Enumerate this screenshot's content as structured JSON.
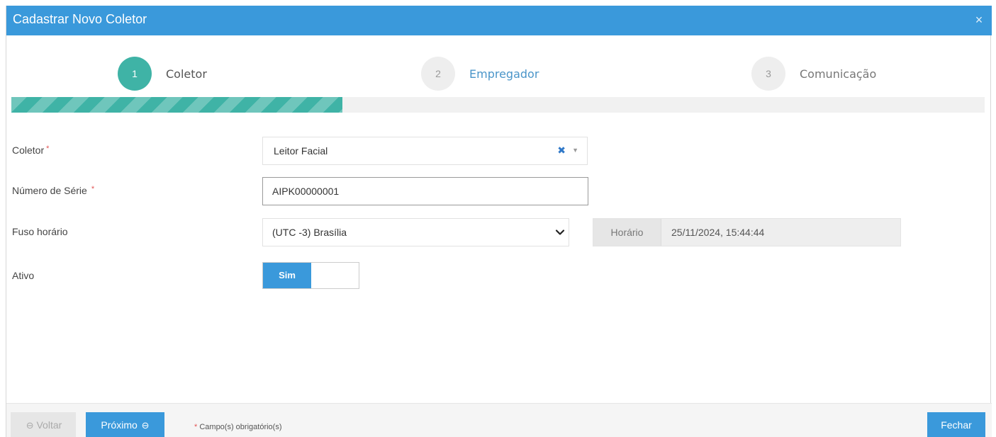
{
  "modal": {
    "title": "Cadastrar Novo Coletor",
    "close_glyph": "×"
  },
  "steps": [
    {
      "number": "1",
      "label": "Coletor",
      "state": "active"
    },
    {
      "number": "2",
      "label": "Empregador",
      "state": "upcoming"
    },
    {
      "number": "3",
      "label": "Comunicação",
      "state": "upcoming"
    }
  ],
  "progress": {
    "current_step": 1,
    "total_steps": 3,
    "fraction": 0.34
  },
  "form": {
    "coletor": {
      "label": "Coletor",
      "required_mark": "*",
      "value": "Leitor Facial"
    },
    "numero_serie": {
      "label": "Número de Série",
      "required_mark": "*",
      "value": "AIPK00000001"
    },
    "fuso_horario": {
      "label": "Fuso horário",
      "value": "(UTC -3) Brasília"
    },
    "horario": {
      "label": "Horário",
      "value": "25/11/2024, 15:44:44"
    },
    "ativo": {
      "label": "Ativo",
      "value": "Sim"
    }
  },
  "footer": {
    "back_label": "Voltar",
    "next_label": "Próximo",
    "close_label": "Fechar",
    "required_star": "*",
    "required_note": "Campo(s) obrigatório(s)"
  },
  "colors": {
    "header": "#3a99db",
    "step_active": "#3fb3a6",
    "primary_button": "#3a99db",
    "required": "#e25555"
  },
  "icons": {
    "close": "close-icon",
    "clear": "clear-icon",
    "caret": "caret-down-icon",
    "chevron": "chevron-down-icon",
    "back": "circle-arrow-left-icon",
    "next": "circle-arrow-right-icon"
  }
}
